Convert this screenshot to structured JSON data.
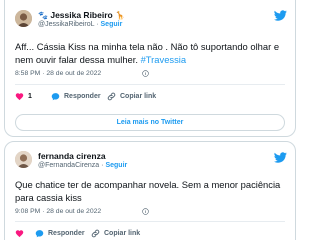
{
  "tweets": [
    {
      "name": "Jessika Ribeiro",
      "name_emoji_right": "🦒",
      "handle": "@JessikaRibeiroL",
      "separator": "·",
      "follow_label": "Seguir",
      "text": "Aff... Cássia Kiss na minha tela não . Não tô suportando olhar e nem ouvir falar dessa mulher. ",
      "hashtag": "#Travessia",
      "timestamp": "8:58 PM · 28 de out de 2022",
      "likes": "1",
      "reply_label": "Responder",
      "copy_label": "Copiar link",
      "more_label": "Leia mais no Twitter"
    },
    {
      "name": "fernanda cirenza",
      "handle": "@FernandaCirenza",
      "separator": "·",
      "follow_label": "Seguir",
      "text": "Que chatice ter de acompanhar novela. Sem a menor paciência para cassia kiss",
      "timestamp": "9:08 PM · 28 de out de 2022",
      "reply_label": "Responder",
      "copy_label": "Copiar link"
    }
  ],
  "colors": {
    "accent": "#1d9bf0",
    "like": "#f91880",
    "muted": "#536471",
    "border": "#cfd9de"
  }
}
